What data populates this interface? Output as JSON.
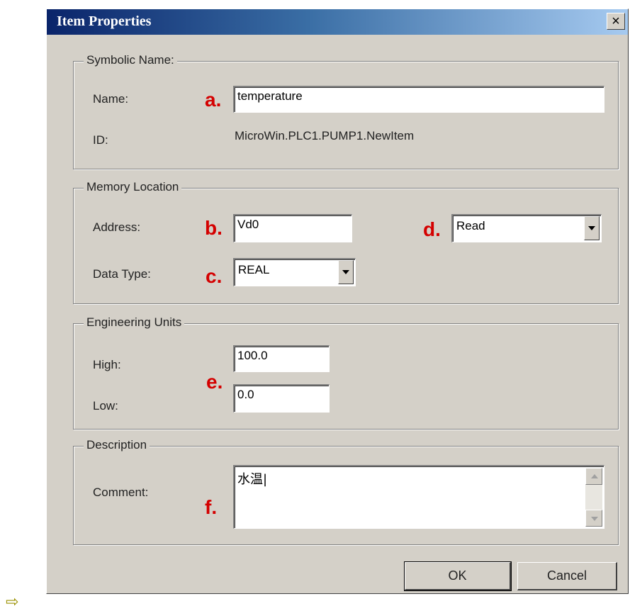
{
  "dialog": {
    "title": "Item Properties",
    "close_glyph": "×"
  },
  "symbolic": {
    "legend": "Symbolic Name:",
    "name_label": "Name:",
    "name_marker": "a.",
    "name_value": "temperature",
    "id_label": "ID:",
    "id_value": "MicroWin.PLC1.PUMP1.NewItem"
  },
  "memory": {
    "legend": "Memory Location",
    "address_label": "Address:",
    "address_marker": "b.",
    "address_value": "Vd0",
    "datatype_label": "Data Type:",
    "datatype_marker": "c.",
    "datatype_value": "REAL",
    "access_marker": "d.",
    "access_value": "Read"
  },
  "engineering": {
    "legend": "Engineering Units",
    "high_label": "High:",
    "high_value": "100.0",
    "low_label": "Low:",
    "low_value": "0.0",
    "marker": "e."
  },
  "description": {
    "legend": "Description",
    "comment_label": "Comment:",
    "marker": "f.",
    "comment_value": "水温|"
  },
  "buttons": {
    "ok": "OK",
    "cancel": "Cancel"
  },
  "footer": {
    "arrow_glyph": "⇨"
  },
  "colors": {
    "dialog_bg": "#d4d0c8",
    "titlebar_start": "#0a246a",
    "titlebar_end": "#a6caf0",
    "marker": "#d40000"
  },
  "icons": [
    "close-icon",
    "dropdown-arrow-icon",
    "scroll-up-icon",
    "scroll-down-icon",
    "arrow-right-icon"
  ]
}
